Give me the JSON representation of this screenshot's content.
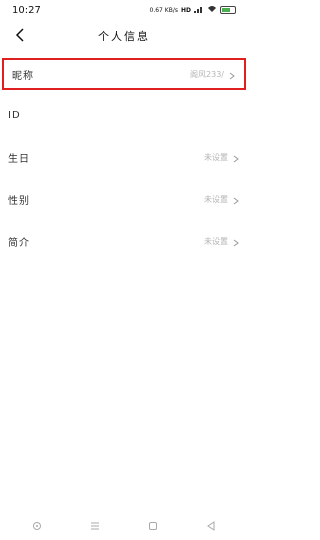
{
  "status_bar": {
    "time": "10:27",
    "net_speed": "0.67\nKB/s",
    "indicators": "HD",
    "battery_level": 0.65
  },
  "header": {
    "title": "个人信息",
    "back_icon": "chevron-left-icon"
  },
  "rows": [
    {
      "label": "昵称",
      "value": "阁风233/",
      "has_chevron": true
    },
    {
      "label": "ID",
      "value": "",
      "has_chevron": false
    },
    {
      "label": "生日",
      "value": "未设置",
      "has_chevron": true
    },
    {
      "label": "性别",
      "value": "未设置",
      "has_chevron": true
    },
    {
      "label": "简介",
      "value": "未设置",
      "has_chevron": true
    }
  ],
  "bottom_nav": {
    "icons": [
      "circle-icon",
      "menu-icon",
      "square-icon",
      "back-triangle-icon"
    ]
  },
  "colors": {
    "highlight": "#e02020",
    "value_text": "#b5b5b5"
  }
}
